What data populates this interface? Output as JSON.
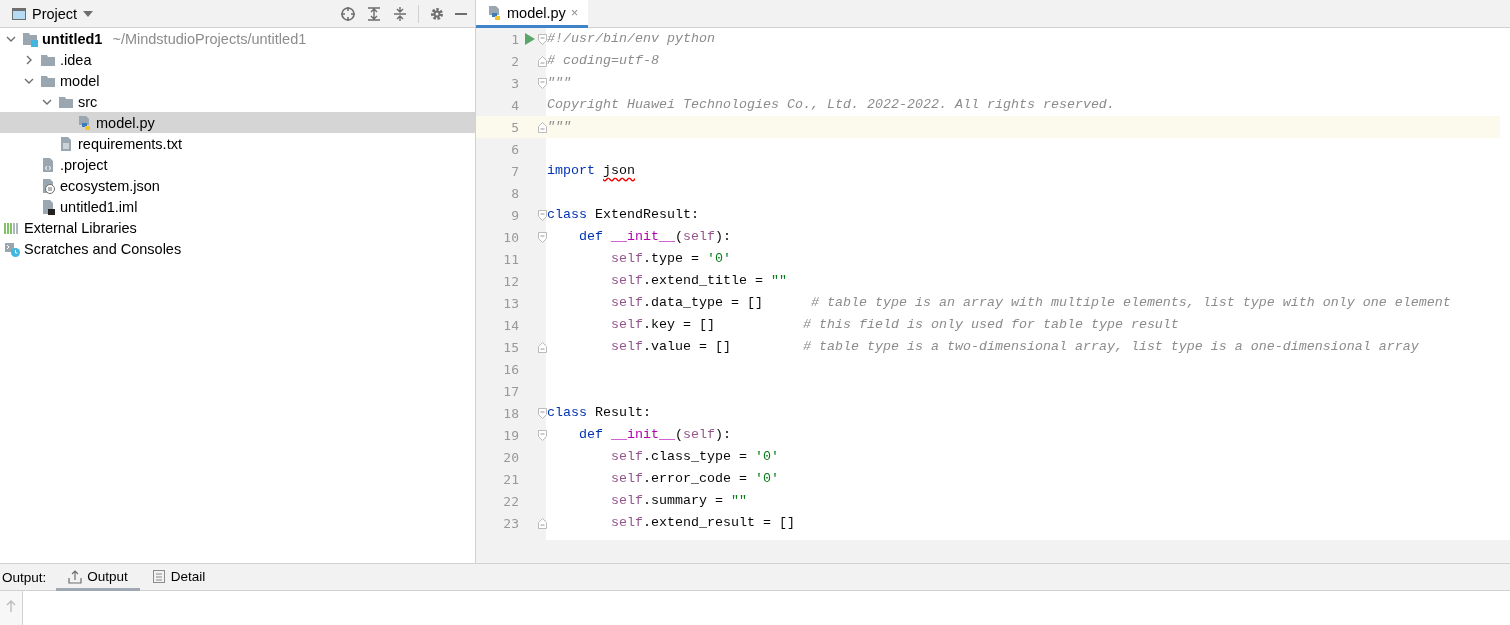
{
  "project_panel": {
    "title": "Project",
    "toolbar": [
      {
        "kind": "locate"
      },
      {
        "kind": "expand-all"
      },
      {
        "kind": "collapse-all"
      },
      {
        "kind": "settings"
      },
      {
        "kind": "minimize"
      }
    ],
    "tree": [
      {
        "name": "untitled1",
        "hint": "~/MindstudioProjects/untitled1",
        "kind": "module",
        "bold": true,
        "expanded": true,
        "selected": false,
        "children": [
          {
            "name": ".idea",
            "kind": "folder",
            "expanded": false,
            "selected": false
          },
          {
            "name": "model",
            "kind": "folder",
            "expanded": true,
            "selected": false,
            "children": [
              {
                "name": "src",
                "kind": "folder",
                "expanded": true,
                "selected": false,
                "children": [
                  {
                    "name": "model.py",
                    "kind": "python",
                    "selected": true
                  }
                ]
              },
              {
                "name": "requirements.txt",
                "kind": "text",
                "selected": false
              }
            ]
          },
          {
            "name": ".project",
            "kind": "xml",
            "selected": false
          },
          {
            "name": "ecosystem.json",
            "kind": "json",
            "selected": false
          },
          {
            "name": "untitled1.iml",
            "kind": "iml",
            "selected": false
          }
        ]
      },
      {
        "name": "External Libraries",
        "kind": "libraries",
        "selected": false
      },
      {
        "name": "Scratches and Consoles",
        "kind": "scratches",
        "selected": false
      }
    ]
  },
  "editor": {
    "tabs": [
      {
        "label": "model.py",
        "close": "×",
        "selected": true
      }
    ],
    "lines": [
      {
        "number": "1",
        "run": true,
        "fold_marker": {
          "kind": "start"
        },
        "tokens": [
          {
            "kind": "comment",
            "text": "#!/usr/bin/env python"
          }
        ]
      },
      {
        "number": "2",
        "fold_marker": {
          "kind": "end"
        },
        "tokens": [
          {
            "kind": "comment",
            "text": "# coding=utf-8"
          }
        ]
      },
      {
        "number": "3",
        "fold_marker": {
          "kind": "start"
        },
        "tokens": [
          {
            "kind": "comment",
            "text": "\"\"\""
          }
        ]
      },
      {
        "number": "4",
        "tokens": [
          {
            "kind": "comment",
            "text": "Copyright Huawei Technologies Co., Ltd. 2022-2022. All rights reserved."
          }
        ]
      },
      {
        "number": "5",
        "fold_marker": {
          "kind": "end"
        },
        "current": true,
        "tokens": [
          {
            "kind": "comment",
            "text": "\"\"\""
          }
        ]
      },
      {
        "number": "6"
      },
      {
        "number": "7",
        "tokens": [
          {
            "kind": "keyword",
            "text": "import "
          },
          {
            "kind": "unresolved",
            "text": "json"
          }
        ]
      },
      {
        "number": "8"
      },
      {
        "number": "9",
        "fold_marker": {
          "kind": "start"
        },
        "tokens": [
          {
            "kind": "keyword",
            "text": "class"
          },
          {
            "kind": "plain",
            "text": " ExtendResult:"
          }
        ]
      },
      {
        "number": "10",
        "fold_marker": {
          "kind": "start"
        },
        "tokens": [
          {
            "kind": "keyword",
            "text": "    def "
          },
          {
            "kind": "magic",
            "text": "__init__"
          },
          {
            "kind": "plain",
            "text": "("
          },
          {
            "kind": "self",
            "text": "self"
          },
          {
            "kind": "plain",
            "text": "):"
          }
        ]
      },
      {
        "number": "11",
        "tokens": [
          {
            "kind": "self",
            "text": "        self"
          },
          {
            "kind": "plain",
            "text": ".type = "
          },
          {
            "kind": "string",
            "text": "'0'"
          }
        ]
      },
      {
        "number": "12",
        "tokens": [
          {
            "kind": "self",
            "text": "        self"
          },
          {
            "kind": "plain",
            "text": ".extend_title = "
          },
          {
            "kind": "string",
            "text": "\"\""
          }
        ]
      },
      {
        "number": "13",
        "tokens": [
          {
            "kind": "self",
            "text": "        self"
          },
          {
            "kind": "plain",
            "text": ".data_type = []      "
          },
          {
            "kind": "comment",
            "text": "# table type is an array with multiple elements, list type with only one element"
          }
        ]
      },
      {
        "number": "14",
        "tokens": [
          {
            "kind": "self",
            "text": "        self"
          },
          {
            "kind": "plain",
            "text": ".key = []           "
          },
          {
            "kind": "comment",
            "text": "# this field is only used for table type result"
          }
        ]
      },
      {
        "number": "15",
        "fold_marker": {
          "kind": "end"
        },
        "tokens": [
          {
            "kind": "self",
            "text": "        self"
          },
          {
            "kind": "plain",
            "text": ".value = []         "
          },
          {
            "kind": "comment",
            "text": "# table type is a two-dimensional array, list type is a one-dimensional array"
          }
        ]
      },
      {
        "number": "16"
      },
      {
        "number": "17"
      },
      {
        "number": "18",
        "fold_marker": {
          "kind": "start"
        },
        "tokens": [
          {
            "kind": "keyword",
            "text": "class"
          },
          {
            "kind": "plain",
            "text": " Result:"
          }
        ]
      },
      {
        "number": "19",
        "fold_marker": {
          "kind": "start"
        },
        "tokens": [
          {
            "kind": "keyword",
            "text": "    def "
          },
          {
            "kind": "magic",
            "text": "__init__"
          },
          {
            "kind": "plain",
            "text": "("
          },
          {
            "kind": "self",
            "text": "self"
          },
          {
            "kind": "plain",
            "text": "):"
          }
        ]
      },
      {
        "number": "20",
        "tokens": [
          {
            "kind": "self",
            "text": "        self"
          },
          {
            "kind": "plain",
            "text": ".class_type = "
          },
          {
            "kind": "string",
            "text": "'0'"
          }
        ]
      },
      {
        "number": "21",
        "tokens": [
          {
            "kind": "self",
            "text": "        self"
          },
          {
            "kind": "plain",
            "text": ".error_code = "
          },
          {
            "kind": "string",
            "text": "'0'"
          }
        ]
      },
      {
        "number": "22",
        "tokens": [
          {
            "kind": "self",
            "text": "        self"
          },
          {
            "kind": "plain",
            "text": ".summary = "
          },
          {
            "kind": "string",
            "text": "\"\""
          }
        ]
      },
      {
        "number": "23",
        "fold_marker": {
          "kind": "end"
        },
        "tokens": [
          {
            "kind": "self",
            "text": "        self"
          },
          {
            "kind": "plain",
            "text": ".extend_result = []"
          }
        ]
      }
    ]
  },
  "output_panel": {
    "label": "Output:",
    "tabs": [
      {
        "label": "Output",
        "selected": true
      },
      {
        "label": "Detail",
        "selected": false
      }
    ]
  }
}
